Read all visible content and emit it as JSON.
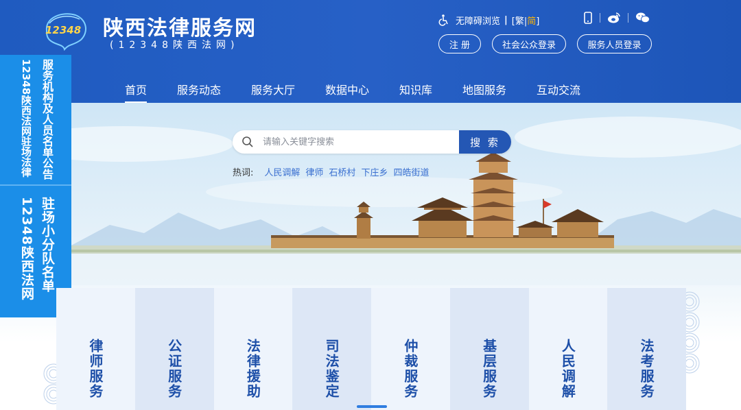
{
  "header": {
    "logo_text": "12348",
    "title": "陕西法律服务网",
    "subtitle": "(12348陕西法网)",
    "accessibility_label": "无障碍浏览",
    "lang_trad": "繁",
    "lang_simp": "简",
    "register_label": "注 册",
    "public_login_label": "社会公众登录",
    "staff_login_label": "服务人员登录"
  },
  "nav": {
    "items": [
      "首页",
      "服务动态",
      "服务大厅",
      "数据中心",
      "知识库",
      "地图服务",
      "互动交流"
    ],
    "active": "首页"
  },
  "search": {
    "placeholder": "请输入关键字搜索",
    "button_label": "搜 索",
    "hot_label": "热词:",
    "hot_words": [
      "人民调解",
      "律师",
      "石桥村",
      "下庄乡",
      "四皓街道"
    ]
  },
  "notice": {
    "top_line1": "服务机构及人员名单公告",
    "top_line2": "12348陕西法网驻场法律",
    "bottom_line1": "驻场小分队名单",
    "bottom_line2": "12348陕西法网"
  },
  "services": [
    "律师服务",
    "公证服务",
    "法律援助",
    "司法鉴定",
    "仲裁服务",
    "基层服务",
    "人民调解",
    "法考服务"
  ],
  "colors": {
    "header_blue": "#2760c6",
    "nav_active_underline": "#ffffff",
    "search_button": "#2457b4",
    "hot_link": "#3a6fd0",
    "notice_blue": "#1b8ee8",
    "service_text": "#1d4fa8",
    "lang_highlight": "#ffb400"
  }
}
